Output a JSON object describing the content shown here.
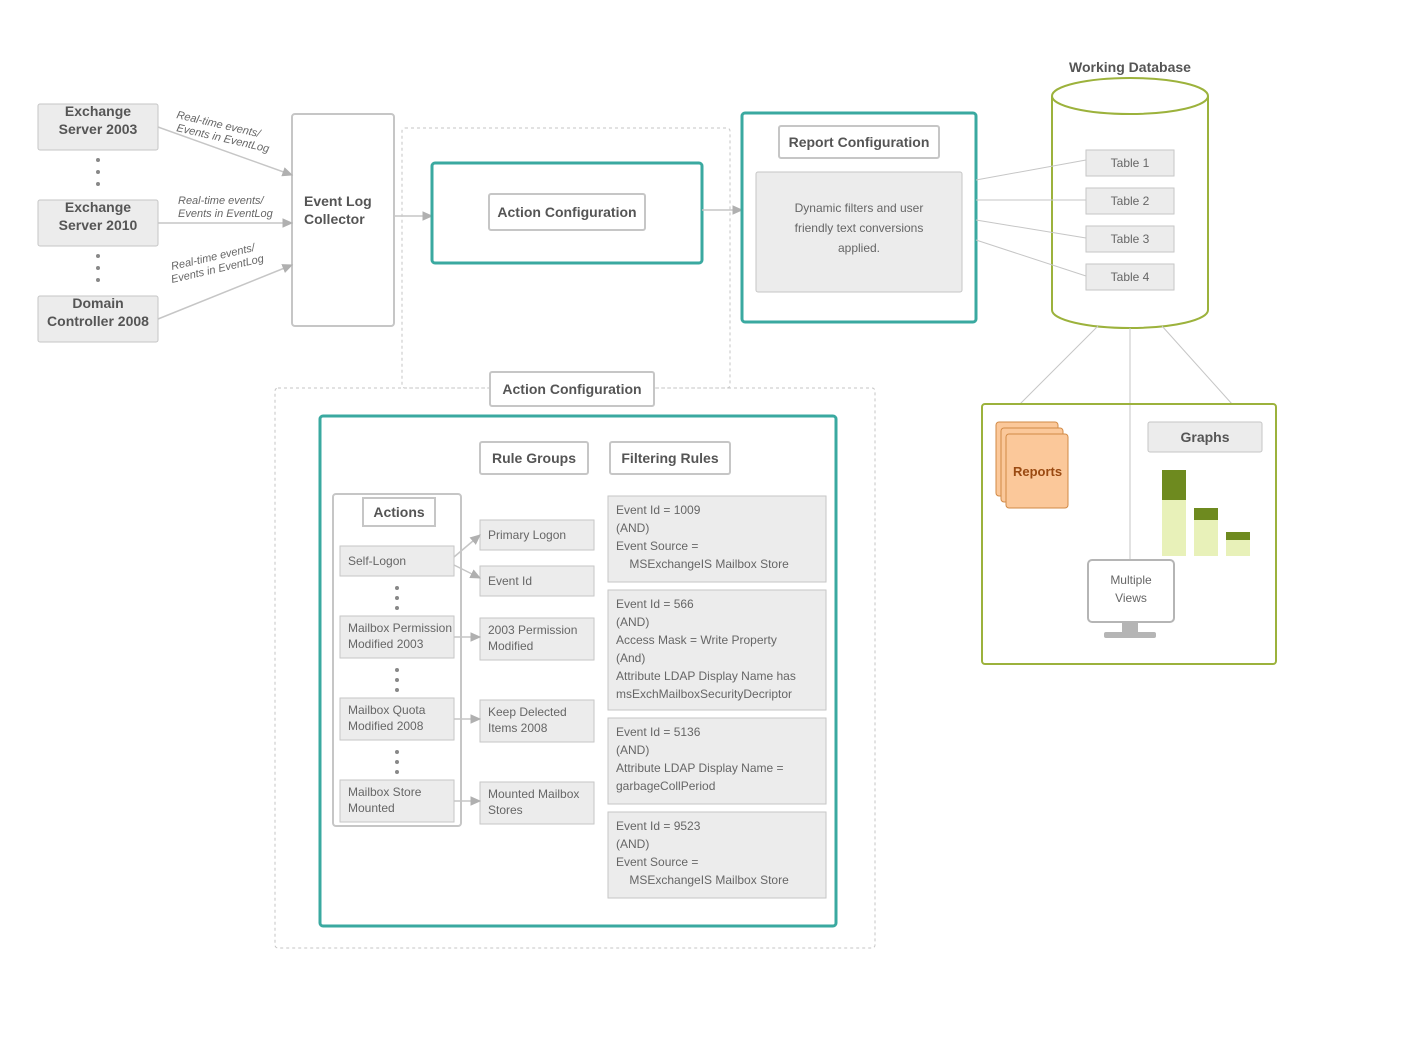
{
  "sources": {
    "s1": "Exchange Server 2003",
    "s2": "Exchange Server 2010",
    "s3": "Domain Controller 2008",
    "edge_l1": "Real-time events/",
    "edge_l2": "Events in EventLog"
  },
  "collector": {
    "title": "Event Log Collector"
  },
  "action_config_summary": {
    "title": "Action Configuration"
  },
  "report_config": {
    "title": "Report Configuration",
    "desc1": "Dynamic filters and user",
    "desc2": "friendly text conversions",
    "desc3": "applied."
  },
  "database": {
    "title": "Working Database",
    "tables": {
      "t1": "Table 1",
      "t2": "Table 2",
      "t3": "Table 3",
      "t4": "Table 4"
    }
  },
  "outputs": {
    "reports": "Reports",
    "graphs": "Graphs",
    "multiviews1": "Multiple",
    "multiviews2": "Views"
  },
  "action_config_detail": {
    "title": "Action Configuration",
    "actions_header": "Actions",
    "actions": {
      "a1": "Self-Logon",
      "a2a": "Mailbox Permission",
      "a2b": "Modified 2003",
      "a3a": "Mailbox Quota",
      "a3b": "Modified 2008",
      "a4a": "Mailbox Store",
      "a4b": "Mounted"
    },
    "rule_groups_header": "Rule Groups",
    "rule_groups": {
      "g1": "Primary Logon",
      "g2": "Event Id",
      "g3a": "2003 Permission",
      "g3b": "Modified",
      "g4a": "Keep Delected",
      "g4b": "Items 2008",
      "g5a": "Mounted Mailbox",
      "g5b": "Stores"
    },
    "filtering_rules_header": "Filtering Rules",
    "rules": {
      "r1": {
        "l1": "Event Id = 1009",
        "l2": "(AND)",
        "l3": "Event Source =",
        "l4": "    MSExchangeIS Mailbox Store"
      },
      "r2": {
        "l1": "Event Id = 566",
        "l2": "(AND)",
        "l3": "Access Mask = Write Property",
        "l4": "(And)",
        "l5": "Attribute LDAP Display Name has",
        "l6": "msExchMailboxSecurityDecriptor"
      },
      "r3": {
        "l1": "Event Id = 5136",
        "l2": "(AND)",
        "l3": "Attribute LDAP Display Name =",
        "l4": "garbageCollPeriod"
      },
      "r4": {
        "l1": "Event Id = 9523",
        "l2": "(AND)",
        "l3": "Event Source =",
        "l4": "    MSExchangeIS Mailbox Store"
      }
    }
  }
}
